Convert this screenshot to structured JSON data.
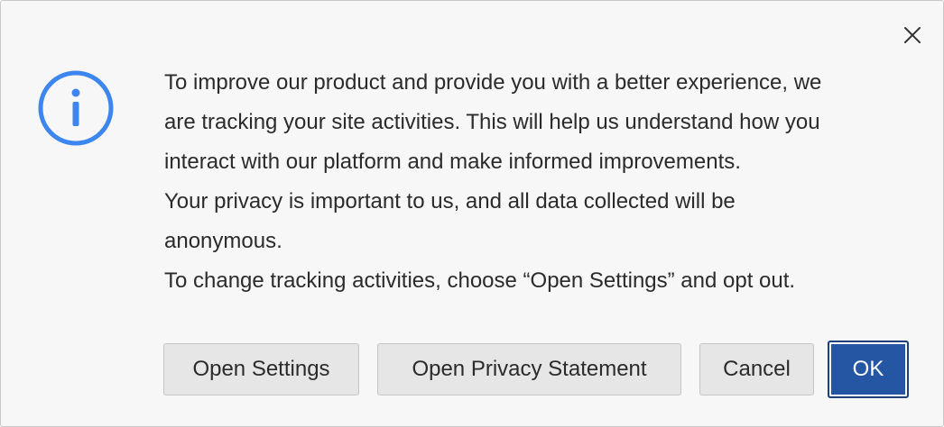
{
  "dialog": {
    "close_icon": "close-icon",
    "info_icon": "info-icon",
    "accent_color": "#3d86f0",
    "message_lines": [
      "To improve our product and provide you with a better experience, we",
      "are tracking your site activities. This will help us understand how you",
      "interact with our platform and make informed improvements.",
      "Your privacy is important to us, and all data collected will be",
      "anonymous.",
      "To change tracking activities, choose “Open Settings” and opt out."
    ],
    "buttons": {
      "open_settings": "Open Settings",
      "open_privacy_statement": "Open Privacy Statement",
      "cancel": "Cancel",
      "ok": "OK"
    },
    "primary_button_color": "#2456a4"
  }
}
